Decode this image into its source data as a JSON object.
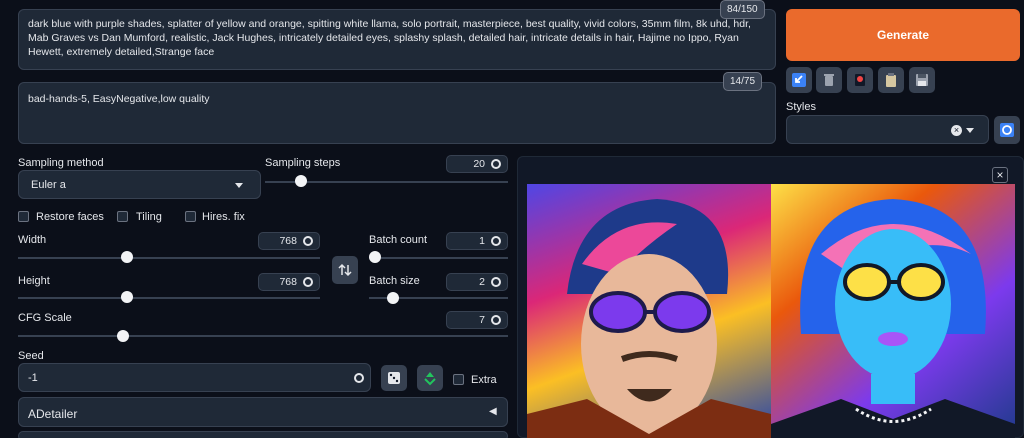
{
  "prompt": {
    "text": "dark blue with purple shades, splatter of yellow and orange, spitting white llama, solo portrait, masterpiece, best quality, vivid colors, 35mm film, 8k uhd, hdr, Mab Graves vs Dan Mumford, realistic, Jack Hughes, intricately detailed eyes, splashy splash, detailed hair, intricate details in hair, Hajime no Ippo, Ryan Hewett, extremely detailed,Strange face",
    "token_count": "84/150"
  },
  "negative_prompt": {
    "text": "bad-hands-5, EasyNegative,low quality",
    "token_count": "14/75"
  },
  "generate": {
    "label": "Generate"
  },
  "styles": {
    "label": "Styles"
  },
  "sampling_method": {
    "label": "Sampling method",
    "value": "Euler a"
  },
  "sampling_steps": {
    "label": "Sampling steps",
    "value": "20",
    "fraction": 0.13
  },
  "checkboxes": {
    "restore_faces": "Restore faces",
    "tiling": "Tiling",
    "hires_fix": "Hires. fix"
  },
  "width": {
    "label": "Width",
    "value": "768",
    "fraction": 0.36
  },
  "height": {
    "label": "Height",
    "value": "768",
    "fraction": 0.36
  },
  "batch_count": {
    "label": "Batch count",
    "value": "1",
    "fraction": 0.0
  },
  "batch_size": {
    "label": "Batch size",
    "value": "2",
    "fraction": 0.14
  },
  "cfg_scale": {
    "label": "CFG Scale",
    "value": "7",
    "fraction": 0.21
  },
  "seed": {
    "label": "Seed",
    "value": "-1",
    "extra_label": "Extra"
  },
  "adetailer": {
    "label": "ADetailer",
    "arrow": "◀"
  },
  "close_glyph": "×",
  "icons": [
    "arrow-icon",
    "trash-icon",
    "paint-icon",
    "clipboard-icon",
    "save-icon",
    "refresh-icon",
    "swap-icon",
    "dice-icon",
    "recycle-icon"
  ]
}
